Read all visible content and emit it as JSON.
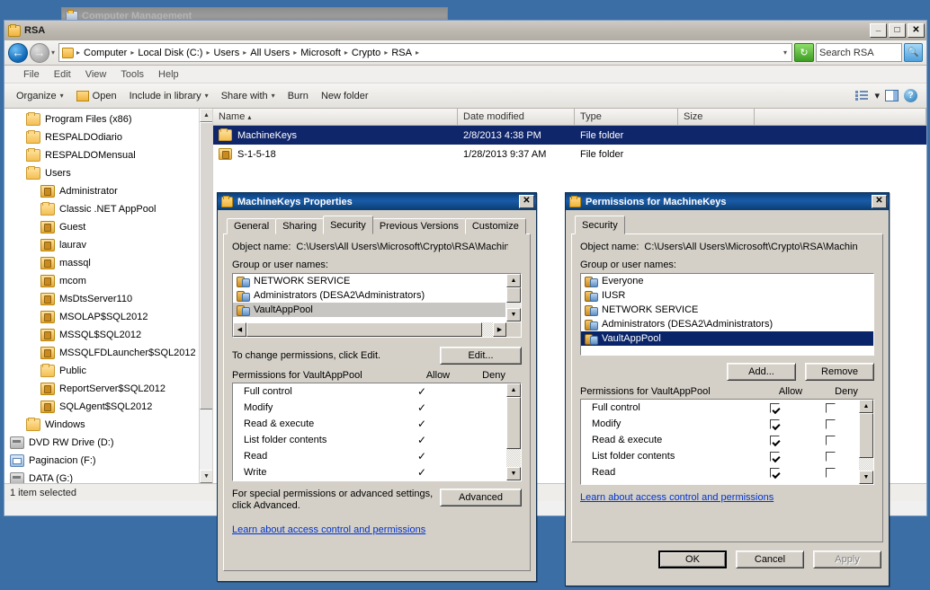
{
  "desktop": {
    "background_color": "#3a6ea5"
  },
  "background_window": {
    "title": "Computer Management"
  },
  "explorer": {
    "title": "RSA",
    "window_buttons": {
      "minimize": "_",
      "maximize": "□",
      "close": "✕"
    },
    "address": {
      "breadcrumbs": [
        "Computer",
        "Local Disk (C:)",
        "Users",
        "All Users",
        "Microsoft",
        "Crypto",
        "RSA"
      ],
      "separator": "▸",
      "dropdown": "▾",
      "refresh_icon": "refresh-icon"
    },
    "search": {
      "placeholder": "Search RSA",
      "value": "Search RSA"
    },
    "menu": [
      "File",
      "Edit",
      "View",
      "Tools",
      "Help"
    ],
    "command_bar": {
      "organize": "Organize",
      "open": "Open",
      "include_in_library": "Include in library",
      "share_with": "Share with",
      "burn": "Burn",
      "new_folder": "New folder",
      "caret": "▾"
    },
    "nav_tree": [
      {
        "label": "Program Files (x86)",
        "icon": "folder-icon",
        "indent": 1
      },
      {
        "label": "RESPALDOdiario",
        "icon": "folder-icon",
        "indent": 1
      },
      {
        "label": "RESPALDOMensual",
        "icon": "folder-icon",
        "indent": 1
      },
      {
        "label": "Users",
        "icon": "folder-icon",
        "indent": 1
      },
      {
        "label": "Administrator",
        "icon": "locked-folder-icon",
        "indent": 2
      },
      {
        "label": "Classic .NET AppPool",
        "icon": "folder-icon",
        "indent": 2
      },
      {
        "label": "Guest",
        "icon": "locked-folder-icon",
        "indent": 2
      },
      {
        "label": "laurav",
        "icon": "locked-folder-icon",
        "indent": 2
      },
      {
        "label": "massql",
        "icon": "locked-folder-icon",
        "indent": 2
      },
      {
        "label": "mcom",
        "icon": "locked-folder-icon",
        "indent": 2
      },
      {
        "label": "MsDtsServer110",
        "icon": "locked-folder-icon",
        "indent": 2
      },
      {
        "label": "MSOLAP$SQL2012",
        "icon": "locked-folder-icon",
        "indent": 2
      },
      {
        "label": "MSSQL$SQL2012",
        "icon": "locked-folder-icon",
        "indent": 2
      },
      {
        "label": "MSSQLFDLauncher$SQL2012",
        "icon": "locked-folder-icon",
        "indent": 2
      },
      {
        "label": "Public",
        "icon": "folder-icon",
        "indent": 2
      },
      {
        "label": "ReportServer$SQL2012",
        "icon": "locked-folder-icon",
        "indent": 2
      },
      {
        "label": "SQLAgent$SQL2012",
        "icon": "locked-folder-icon",
        "indent": 2
      },
      {
        "label": "Windows",
        "icon": "folder-icon",
        "indent": 1
      },
      {
        "label": "DVD RW Drive (D:)",
        "icon": "drive-icon",
        "indent": 0
      },
      {
        "label": "Paginacion (F:)",
        "icon": "network-drive-icon",
        "indent": 0
      },
      {
        "label": "DATA (G:)",
        "icon": "drive-icon",
        "indent": 0
      }
    ],
    "columns": [
      "Name",
      "Date modified",
      "Type",
      "Size"
    ],
    "sort_indicator": "▴",
    "files": [
      {
        "name": "MachineKeys",
        "date": "2/8/2013 4:38 PM",
        "type": "File folder",
        "size": "",
        "icon": "folder-icon",
        "selected": true
      },
      {
        "name": "S-1-5-18",
        "date": "1/28/2013 9:37 AM",
        "type": "File folder",
        "size": "",
        "icon": "locked-folder-icon",
        "selected": false
      }
    ],
    "status": "1 item selected"
  },
  "properties_dialog": {
    "title": "MachineKeys Properties",
    "close_label": "✕",
    "tabs": [
      "General",
      "Sharing",
      "Security",
      "Previous Versions",
      "Customize"
    ],
    "active_tab": "Security",
    "object_name_label": "Object name:",
    "object_name_value": "C:\\Users\\All Users\\Microsoft\\Crypto\\RSA\\MachineKeys",
    "group_label": "Group or user names:",
    "groups": [
      {
        "name": "NETWORK SERVICE",
        "selected": false
      },
      {
        "name": "Administrators (DESA2\\Administrators)",
        "selected": false
      },
      {
        "name": "VaultAppPool",
        "selected": true
      }
    ],
    "edit_hint": "To change permissions, click Edit.",
    "edit_button": "Edit...",
    "permissions_label": "Permissions for VaultAppPool",
    "allow_header": "Allow",
    "deny_header": "Deny",
    "check_glyph": "✓",
    "permissions": [
      {
        "name": "Full control",
        "allow": true,
        "deny": false
      },
      {
        "name": "Modify",
        "allow": true,
        "deny": false
      },
      {
        "name": "Read & execute",
        "allow": true,
        "deny": false
      },
      {
        "name": "List folder contents",
        "allow": true,
        "deny": false
      },
      {
        "name": "Read",
        "allow": true,
        "deny": false
      },
      {
        "name": "Write",
        "allow": true,
        "deny": false
      }
    ],
    "advanced_hint_line1": "For special permissions or advanced settings,",
    "advanced_hint_line2": "click Advanced.",
    "advanced_button": "Advanced",
    "learn_link": "Learn about access control and permissions"
  },
  "permissions_dialog": {
    "title": "Permissions for MachineKeys",
    "close_label": "✕",
    "tabs": [
      "Security"
    ],
    "active_tab": "Security",
    "object_name_label": "Object name:",
    "object_name_value": "C:\\Users\\All Users\\Microsoft\\Crypto\\RSA\\MachineKeys",
    "group_label": "Group or user names:",
    "groups": [
      {
        "name": "Everyone",
        "selected": false
      },
      {
        "name": "IUSR",
        "selected": false
      },
      {
        "name": "NETWORK SERVICE",
        "selected": false
      },
      {
        "name": "Administrators (DESA2\\Administrators)",
        "selected": false
      },
      {
        "name": "VaultAppPool",
        "selected": true
      }
    ],
    "add_button": "Add...",
    "remove_button": "Remove",
    "permissions_label": "Permissions for VaultAppPool",
    "allow_header": "Allow",
    "deny_header": "Deny",
    "permissions": [
      {
        "name": "Full control",
        "allow": true,
        "deny": false
      },
      {
        "name": "Modify",
        "allow": true,
        "deny": false
      },
      {
        "name": "Read & execute",
        "allow": true,
        "deny": false
      },
      {
        "name": "List folder contents",
        "allow": true,
        "deny": false
      },
      {
        "name": "Read",
        "allow": true,
        "deny": false
      }
    ],
    "learn_link": "Learn about access control and permissions",
    "ok_button": "OK",
    "cancel_button": "Cancel",
    "apply_button": "Apply",
    "apply_disabled": true
  }
}
